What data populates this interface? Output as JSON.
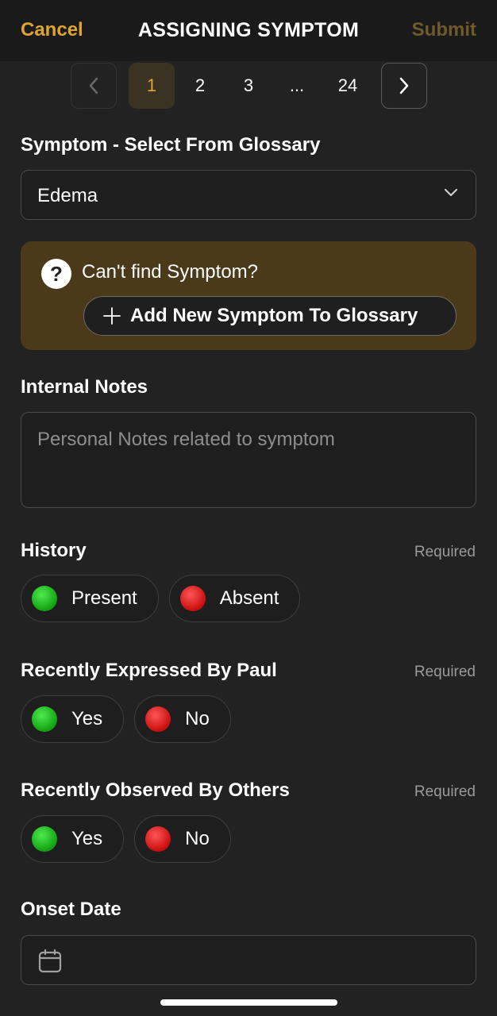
{
  "header": {
    "cancel_label": "Cancel",
    "title": "ASSIGNING SYMPTOM",
    "submit_label": "Submit"
  },
  "pagination": {
    "pages": [
      "1",
      "2",
      "3",
      "...",
      "24"
    ],
    "current": "1"
  },
  "symptom": {
    "label": "Symptom - Select From Glossary",
    "selected_value": "Edema"
  },
  "notice": {
    "message": "Can't find Symptom?",
    "add_button_label": "Add New Symptom To Glossary"
  },
  "internal_notes": {
    "label": "Internal Notes",
    "placeholder": "Personal Notes related to symptom"
  },
  "history": {
    "label": "History",
    "required": "Required",
    "options": [
      "Present",
      "Absent"
    ]
  },
  "expressed": {
    "label": "Recently Expressed By Paul",
    "required": "Required",
    "options": [
      "Yes",
      "No"
    ]
  },
  "observed": {
    "label": "Recently Observed By Others",
    "required": "Required",
    "options": [
      "Yes",
      "No"
    ]
  },
  "onset_date": {
    "label": "Onset Date"
  },
  "colors": {
    "accent": "#e0a52c",
    "submit_disabled": "#6e5a2a",
    "notice_bg": "#4a3a1a",
    "background": "#222222"
  }
}
